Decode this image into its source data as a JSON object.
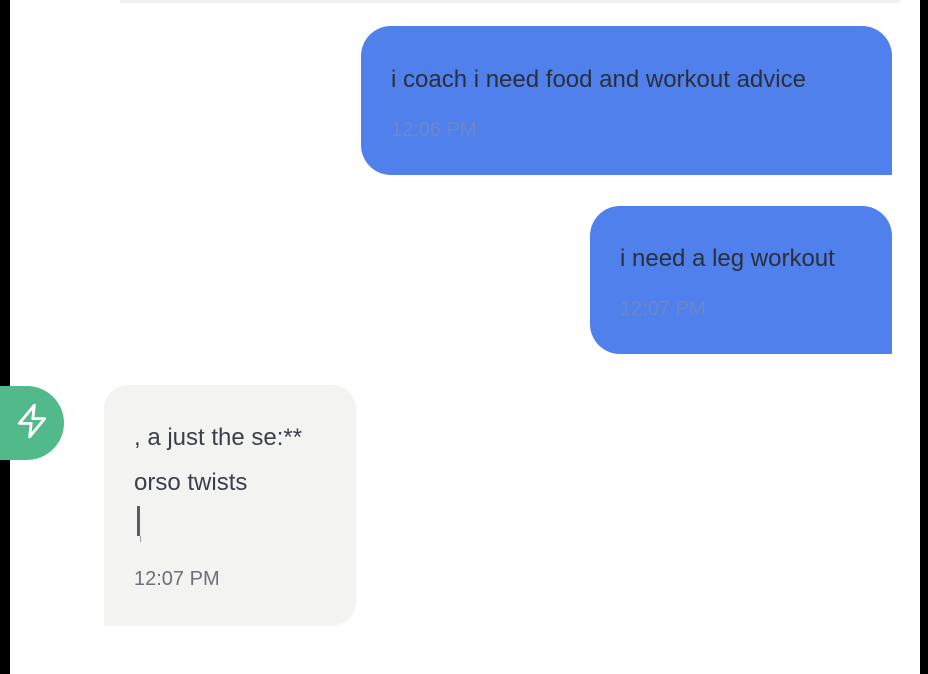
{
  "colors": {
    "user_bubble": "#4f80ec",
    "bot_bubble": "#f3f3f2",
    "avatar_bg": "#52b98a",
    "background": "#ffffff"
  },
  "messages": [
    {
      "sender": "user",
      "text": "i coach i need food and workout advice",
      "time": "12:06 PM"
    },
    {
      "sender": "user",
      "text": "i need a leg workout",
      "time": "12:07 PM"
    },
    {
      "sender": "bot",
      "lines": [
        ", a just the se:**",
        "orso twists"
      ],
      "time": "12:07 PM",
      "typing_cursor": true
    }
  ],
  "avatar": {
    "icon": "lightning-bolt-icon"
  }
}
